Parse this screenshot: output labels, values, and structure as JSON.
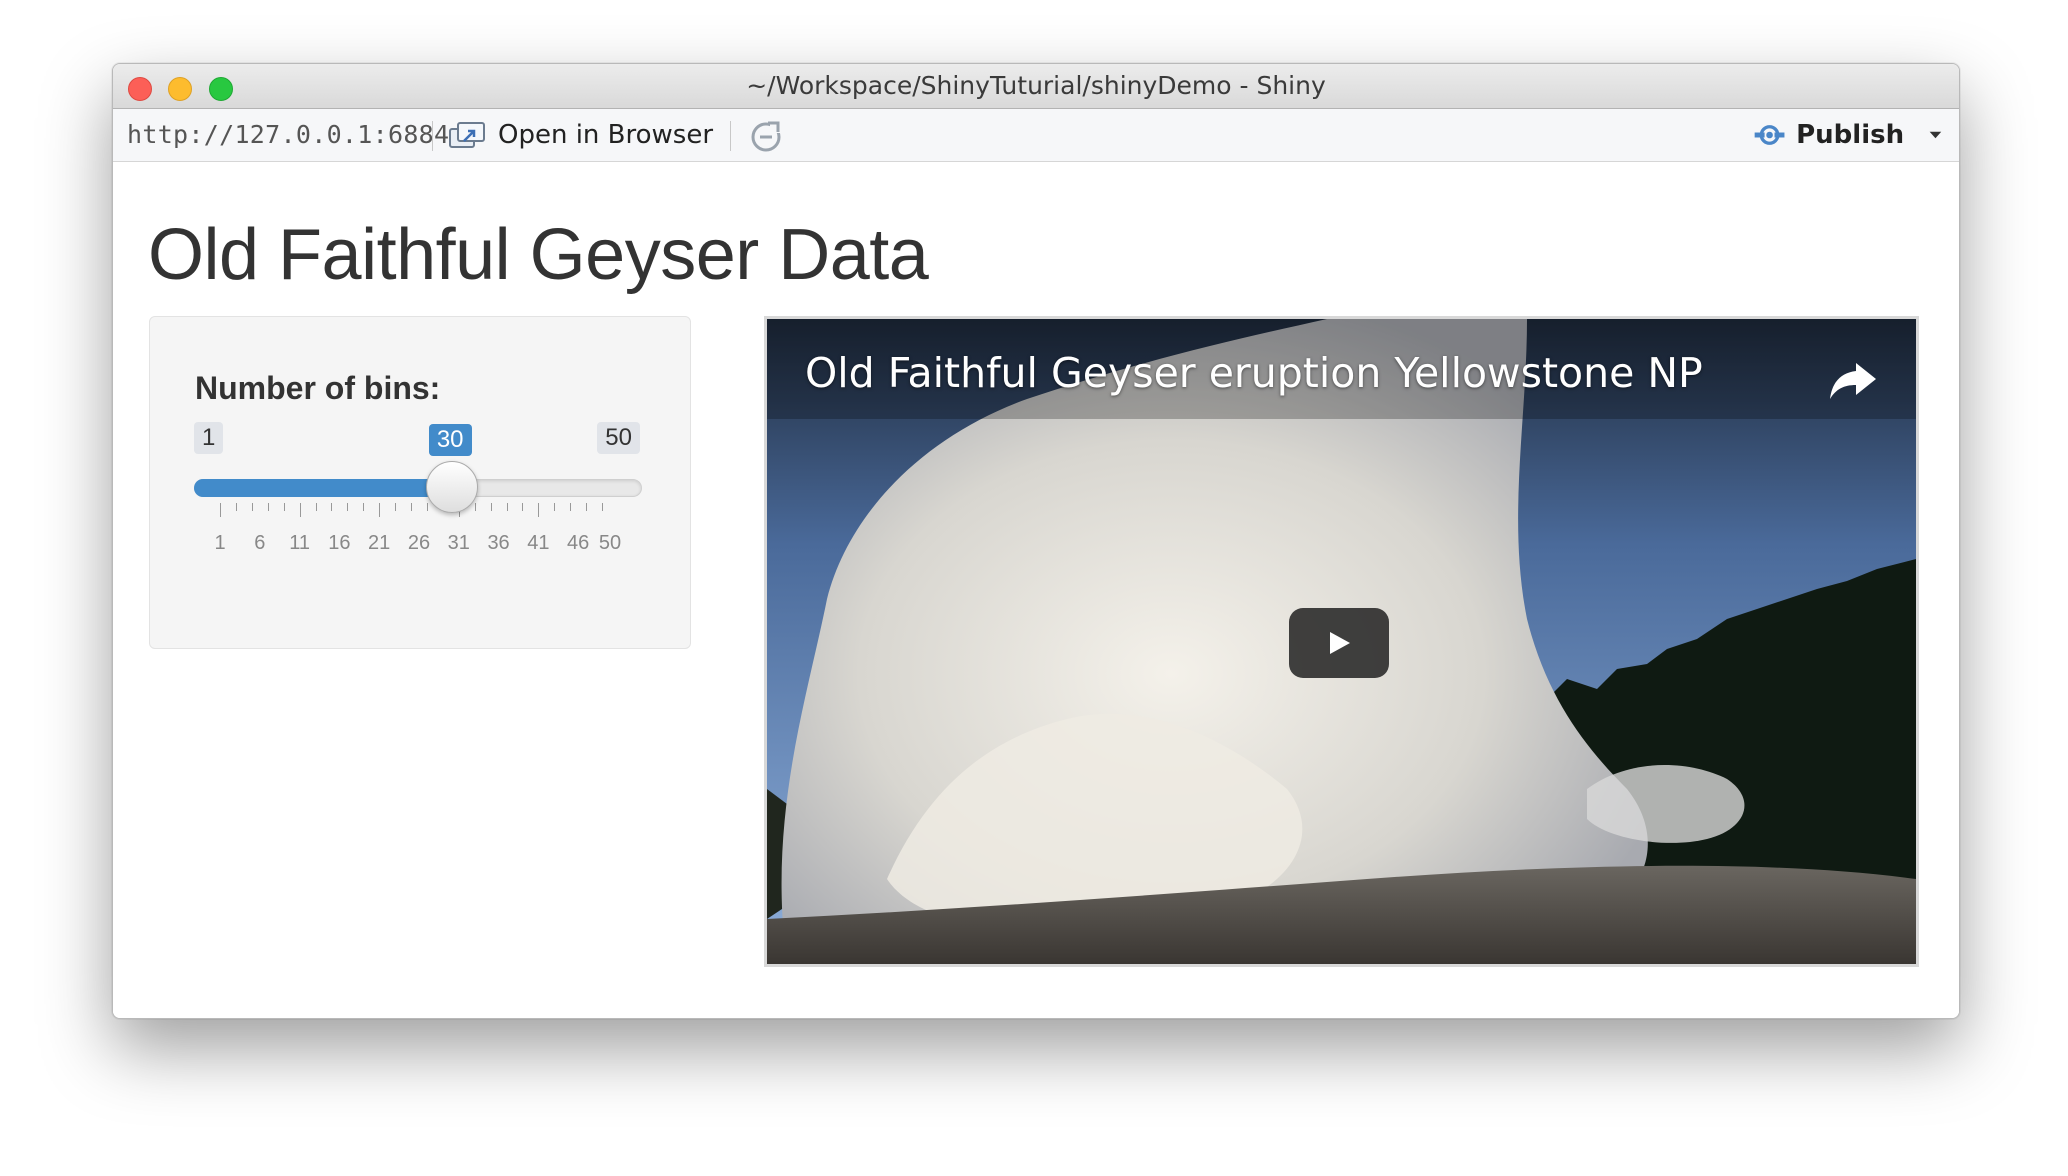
{
  "window": {
    "title": "~/Workspace/ShinyTuturial/shinyDemo - Shiny"
  },
  "toolbar": {
    "url": "http://127.0.0.1:6884",
    "open_in_browser_label": "Open in Browser",
    "publish_label": "Publish"
  },
  "page": {
    "title": "Old Faithful Geyser Data"
  },
  "sidebar": {
    "slider": {
      "label": "Number of bins:",
      "min": 1,
      "max": 50,
      "value": 30,
      "min_label": "1",
      "max_label": "50",
      "value_label": "30",
      "tick_labels": [
        "1",
        "6",
        "11",
        "16",
        "21",
        "26",
        "31",
        "36",
        "41",
        "46",
        "50"
      ],
      "accent_color": "#428bca"
    }
  },
  "video": {
    "title": "Old Faithful Geyser eruption Yellowstone NP",
    "icons": [
      "share-icon",
      "play-icon"
    ]
  }
}
